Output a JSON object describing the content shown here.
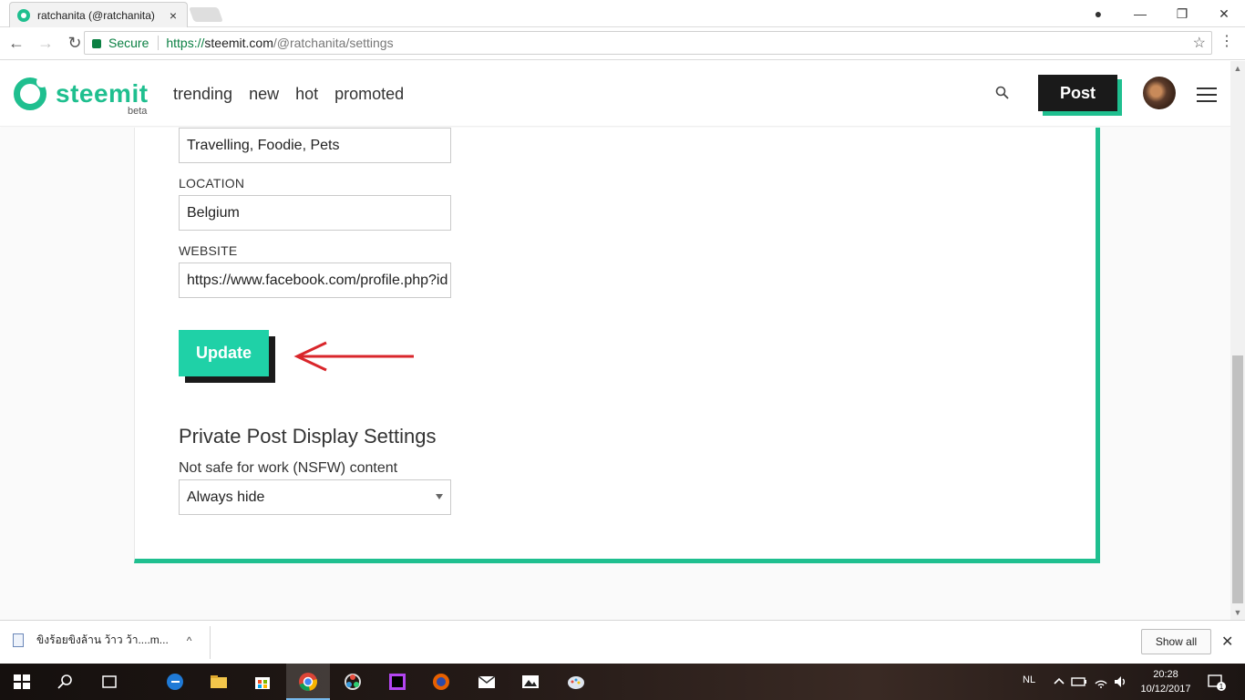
{
  "browser": {
    "tab_title": "ratchanita (@ratchanita)",
    "tab_close": "×",
    "secure_label": "Secure",
    "url_scheme": "https://",
    "url_host": "steemit.com",
    "url_path": "/@ratchanita/settings",
    "window_controls": [
      "—",
      "❐",
      "✕"
    ],
    "profile_icon": "●",
    "star": "☆",
    "menu": "⋮",
    "back": "←",
    "forward": "→",
    "reload": "↻"
  },
  "site": {
    "brand": "steemit",
    "beta": "beta",
    "nav": [
      "trending",
      "new",
      "hot",
      "promoted"
    ],
    "post_label": "Post",
    "accent": "#1fbf8f",
    "button_accent": "#1fd1a7"
  },
  "form": {
    "about_value": "Travelling, Foodie, Pets",
    "location_label": "LOCATION",
    "location_value": "Belgium",
    "website_label": "WEBSITE",
    "website_value": "https://www.facebook.com/profile.php?id",
    "update_label": "Update",
    "section_title": "Private Post Display Settings",
    "nsfw_label": "Not safe for work (NSFW) content",
    "nsfw_selected": "Always hide"
  },
  "downloads": {
    "file_name": "ขิงร้อยขิงล้าน ว้าว ว้า....m...",
    "chevron": "^",
    "show_all": "Show all",
    "close": "✕"
  },
  "taskbar": {
    "language": "NL",
    "time": "20:28",
    "date": "10/12/2017",
    "notification_count": "1"
  }
}
